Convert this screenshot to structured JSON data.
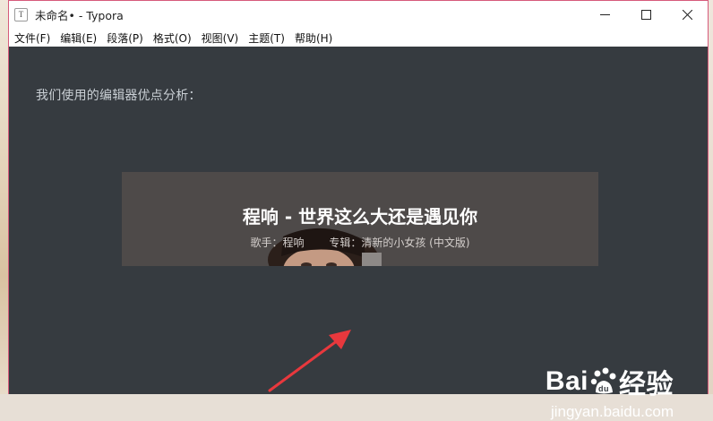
{
  "window": {
    "app_icon_letter": "T",
    "title": "未命名• - Typora"
  },
  "controls": {
    "minimize": "minimize-icon",
    "maximize": "maximize-icon",
    "close": "close-icon"
  },
  "menu": {
    "items": [
      "文件(F)",
      "编辑(E)",
      "段落(P)",
      "格式(O)",
      "视图(V)",
      "主题(T)",
      "帮助(H)"
    ]
  },
  "document": {
    "text": "我们使用的编辑器优点分析："
  },
  "music_card": {
    "title": "程响 - 世界这么大还是遇见你",
    "singer": "歌手：程响",
    "album": "专辑：清新的小女孩 (中文版)"
  },
  "watermark": {
    "brand": "Baidu经验",
    "url": "jingyan.baidu.com"
  },
  "colors": {
    "editor_bg": "#363b40",
    "card_bg": "#4e4a49",
    "arrow": "#e8383d",
    "window_border": "#d65b7b"
  }
}
